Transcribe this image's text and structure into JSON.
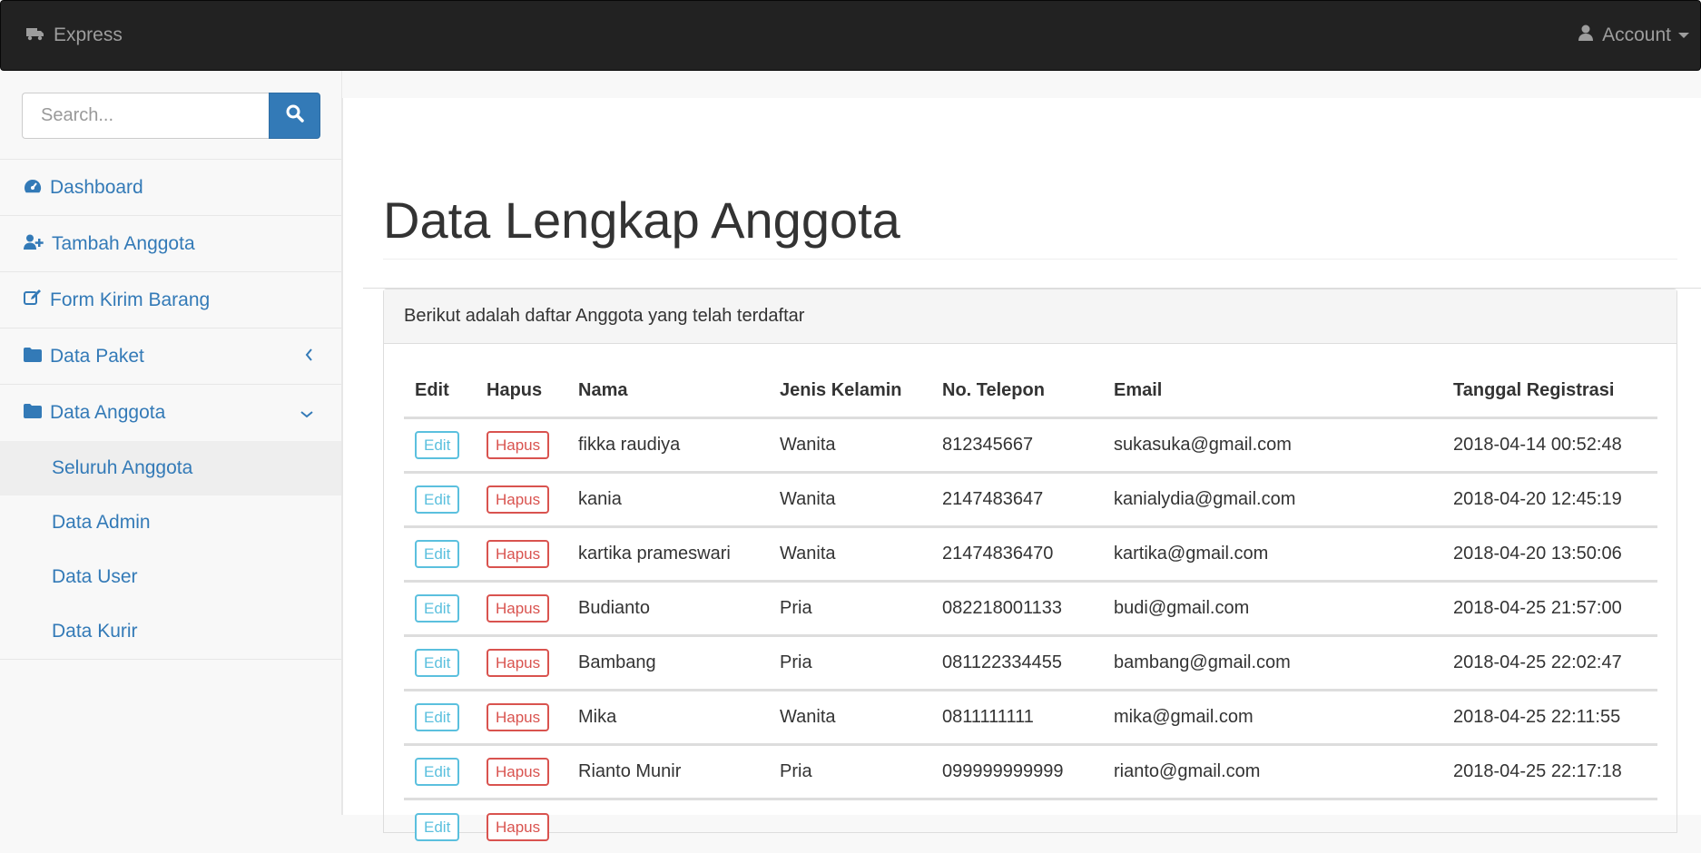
{
  "navbar": {
    "brand": "Express",
    "brand_icon": "truck-icon",
    "account_label": "Account",
    "account_icon": "user-icon"
  },
  "sidebar": {
    "search_placeholder": "Search...",
    "items": [
      {
        "label": "Dashboard",
        "icon": "dashboard-icon"
      },
      {
        "label": "Tambah Anggota",
        "icon": "user-plus-icon"
      },
      {
        "label": "Form Kirim Barang",
        "icon": "edit-icon"
      },
      {
        "label": "Data Paket",
        "icon": "folder-icon"
      },
      {
        "label": "Data Anggota",
        "icon": "folder-icon"
      }
    ],
    "sub_items": [
      {
        "label": "Seluruh Anggota"
      },
      {
        "label": "Data Admin"
      },
      {
        "label": "Data User"
      },
      {
        "label": "Data Kurir"
      }
    ]
  },
  "main": {
    "title": "Data Lengkap Anggota",
    "panel_heading": "Berikut adalah daftar Anggota yang telah terdaftar",
    "columns": [
      "Edit",
      "Hapus",
      "Nama",
      "Jenis Kelamin",
      "No. Telepon",
      "Email",
      "Tanggal Registrasi"
    ],
    "edit_label": "Edit",
    "hapus_label": "Hapus",
    "rows": [
      {
        "nama": "fikka raudiya",
        "jk": "Wanita",
        "telp": "812345667",
        "email": "sukasuka@gmail.com",
        "tgl": "2018-04-14 00:52:48"
      },
      {
        "nama": "kania",
        "jk": "Wanita",
        "telp": "2147483647",
        "email": "kanialydia@gmail.com",
        "tgl": "2018-04-20 12:45:19"
      },
      {
        "nama": "kartika prameswari",
        "jk": "Wanita",
        "telp": "21474836470",
        "email": "kartika@gmail.com",
        "tgl": "2018-04-20 13:50:06"
      },
      {
        "nama": "Budianto",
        "jk": "Pria",
        "telp": "082218001133",
        "email": "budi@gmail.com",
        "tgl": "2018-04-25 21:57:00"
      },
      {
        "nama": "Bambang",
        "jk": "Pria",
        "telp": "081122334455",
        "email": "bambang@gmail.com",
        "tgl": "2018-04-25 22:02:47"
      },
      {
        "nama": "Mika",
        "jk": "Wanita",
        "telp": "0811111111",
        "email": "mika@gmail.com",
        "tgl": "2018-04-25 22:11:55"
      },
      {
        "nama": "Rianto Munir",
        "jk": "Pria",
        "telp": "099999999999",
        "email": "rianto@gmail.com",
        "tgl": "2018-04-25 22:17:18"
      }
    ]
  },
  "colors": {
    "navbar_bg": "#222222",
    "link": "#337ab7",
    "edit": "#5bc0de",
    "hapus": "#d9534f"
  }
}
